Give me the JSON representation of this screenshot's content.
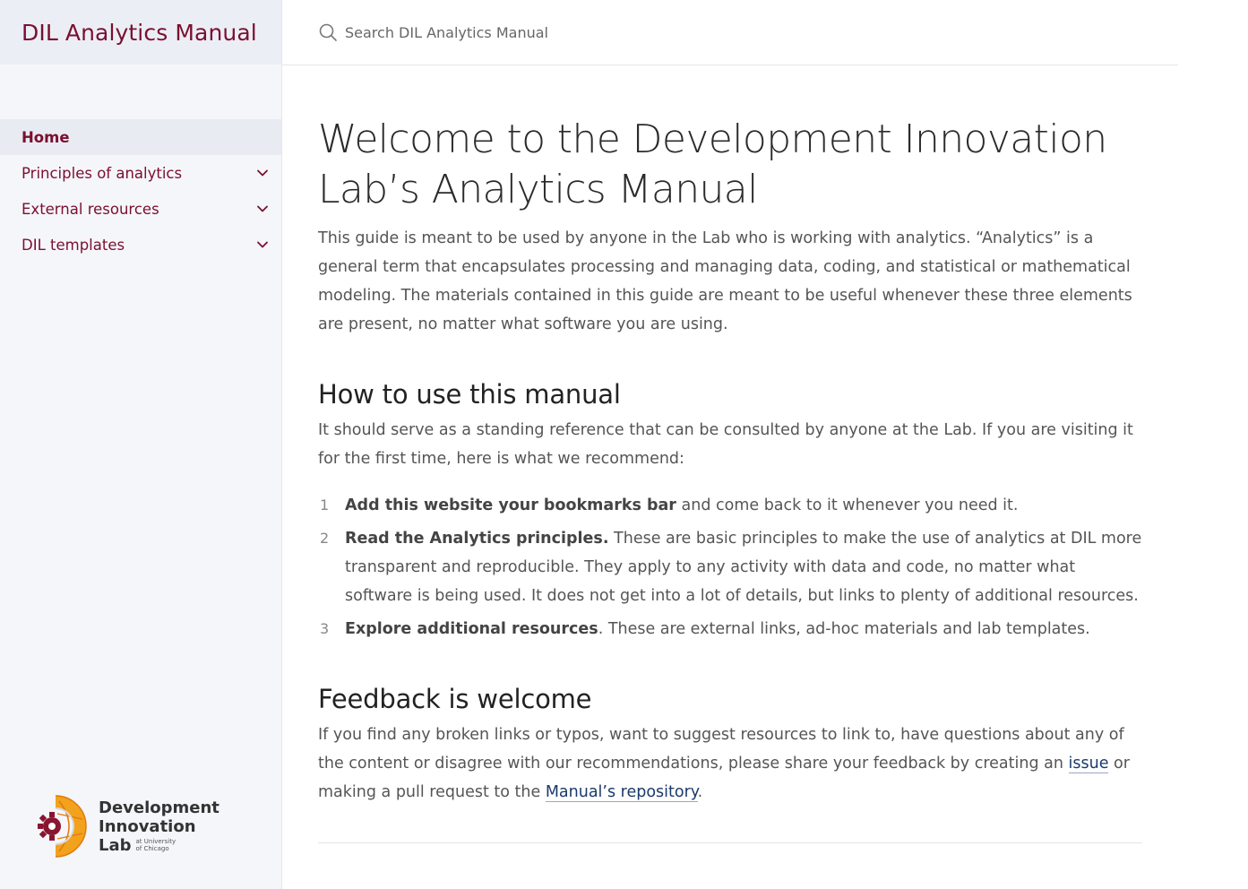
{
  "sidebar": {
    "title": "DIL Analytics Manual",
    "items": [
      {
        "label": "Home",
        "active": true
      },
      {
        "label": "Principles of analytics",
        "expandable": true
      },
      {
        "label": "External resources",
        "expandable": true
      },
      {
        "label": "DIL templates",
        "expandable": true
      }
    ],
    "logo": {
      "line1": "Development",
      "line2": "Innovation",
      "line3": "Lab",
      "sub1": "at University",
      "sub2": "of Chicago"
    }
  },
  "search": {
    "placeholder": "Search DIL Analytics Manual"
  },
  "page": {
    "title": "Welcome to the Development Innovation Lab’s Analytics Manual",
    "intro": "This guide is meant to be used by anyone in the Lab who is working with analytics. “Analytics” is a general term that encapsulates processing and managing data, coding, and statistical or mathematical modeling. The materials contained in this guide are meant to be useful whenever these three elements are present, no matter what software you are using.",
    "section1": {
      "heading": "How to use this manual",
      "text": "It should serve as a standing reference that can be consulted by anyone at the Lab. If you are visiting it for the first time, here is what we recommend:",
      "steps": [
        {
          "num": "1",
          "bold": "Add this website your bookmarks bar",
          "rest": " and come back to it whenever you need it."
        },
        {
          "num": "2",
          "bold": "Read the Analytics principles.",
          "rest": " These are basic principles to make the use of analytics at DIL more transparent and reproducible. They apply to any activity with data and code, no matter what software is being used. It does not get into a lot of details, but links to plenty of additional resources."
        },
        {
          "num": "3",
          "bold": "Explore additional resources",
          "rest": ". These are external links, ad-hoc materials and lab templates."
        }
      ]
    },
    "section2": {
      "heading": "Feedback is welcome",
      "text_a": "If you find any broken links or typos, want to suggest resources to link to, have questions about any of the content or disagree with our recommendations, please share your feedback by creating an ",
      "link1": "issue",
      "text_b": " or making a pull request to the ",
      "link2": "Manual’s repository",
      "text_c": "."
    }
  },
  "colors": {
    "brand": "#7a0f2e",
    "sidebar_bg": "#f5f6fa",
    "link": "#1a3a6a"
  }
}
